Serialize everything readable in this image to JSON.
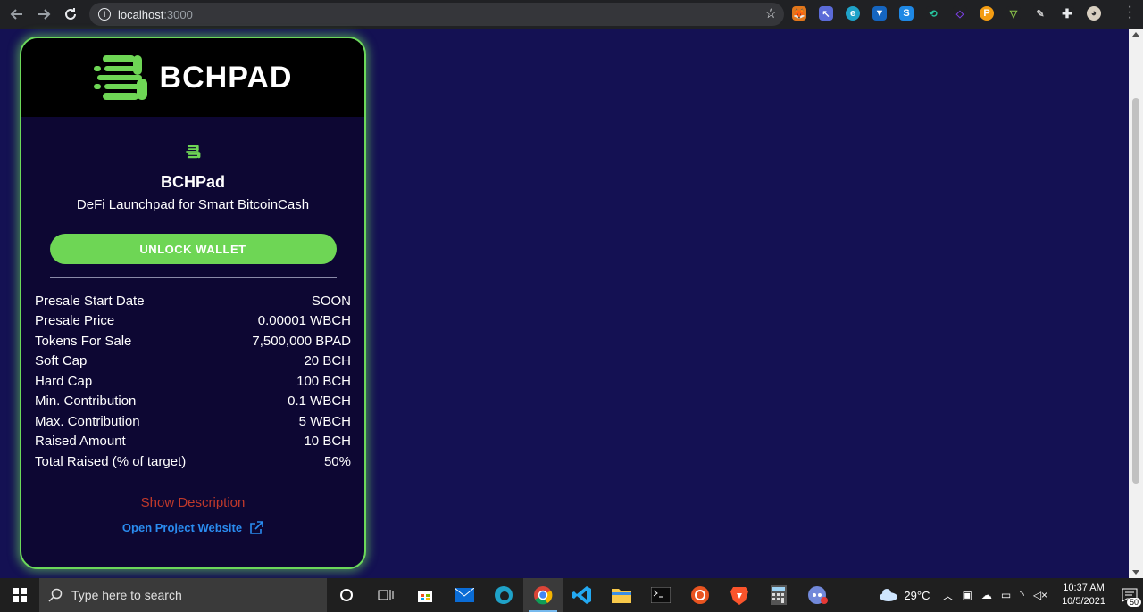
{
  "browser": {
    "url_host": "localhost",
    "url_port": ":3000"
  },
  "card": {
    "brand": "BCHPAD",
    "project_name": "BCHPad",
    "tagline": "DeFi Launchpad for Smart BitcoinCash",
    "unlock_label": "UNLOCK WALLET",
    "details": [
      {
        "label": "Presale Start Date",
        "value": "SOON"
      },
      {
        "label": "Presale Price",
        "value": "0.00001 WBCH"
      },
      {
        "label": "Tokens For Sale",
        "value": "7,500,000 BPAD"
      },
      {
        "label": "Soft Cap",
        "value": "20 BCH"
      },
      {
        "label": "Hard Cap",
        "value": "100 BCH"
      },
      {
        "label": "Min. Contribution",
        "value": "0.1 WBCH"
      },
      {
        "label": "Max. Contribution",
        "value": "5 WBCH"
      },
      {
        "label": "Raised Amount",
        "value": "10 BCH"
      },
      {
        "label": "Total Raised (% of target)",
        "value": "50%"
      }
    ],
    "show_description": "Show Description",
    "open_website": "Open Project Website"
  },
  "colors": {
    "page_bg": "#141153",
    "card_bg": "#0d0733",
    "accent_green": "#6ed655",
    "link_blue": "#2a8cf0",
    "desc_red": "#c0392b"
  },
  "taskbar": {
    "search_placeholder": "Type here to search",
    "weather": "29°C",
    "time": "10:37 AM",
    "date": "10/5/2021",
    "notifications": "50"
  }
}
